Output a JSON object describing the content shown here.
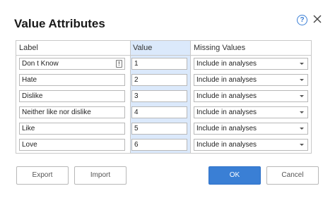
{
  "dialog": {
    "title": "Value Attributes",
    "help_label": "?"
  },
  "grid": {
    "headers": {
      "label": "Label",
      "value": "Value",
      "missing": "Missing Values"
    },
    "note_glyph": "!",
    "rows": [
      {
        "label": "Don t Know",
        "value": "1",
        "missing": "Include in analyses",
        "has_note": true
      },
      {
        "label": "Hate",
        "value": "2",
        "missing": "Include in analyses"
      },
      {
        "label": "Dislike",
        "value": "3",
        "missing": "Include in analyses"
      },
      {
        "label": "Neither like nor dislike",
        "value": "4",
        "missing": "Include in analyses"
      },
      {
        "label": "Like",
        "value": "5",
        "missing": "Include in analyses"
      },
      {
        "label": "Love",
        "value": "6",
        "missing": "Include in analyses"
      }
    ]
  },
  "buttons": {
    "export": "Export",
    "import": "Import",
    "ok": "OK",
    "cancel": "Cancel"
  },
  "colors": {
    "accent": "#3a7fd5",
    "selected_column": "#dbe9fb"
  }
}
